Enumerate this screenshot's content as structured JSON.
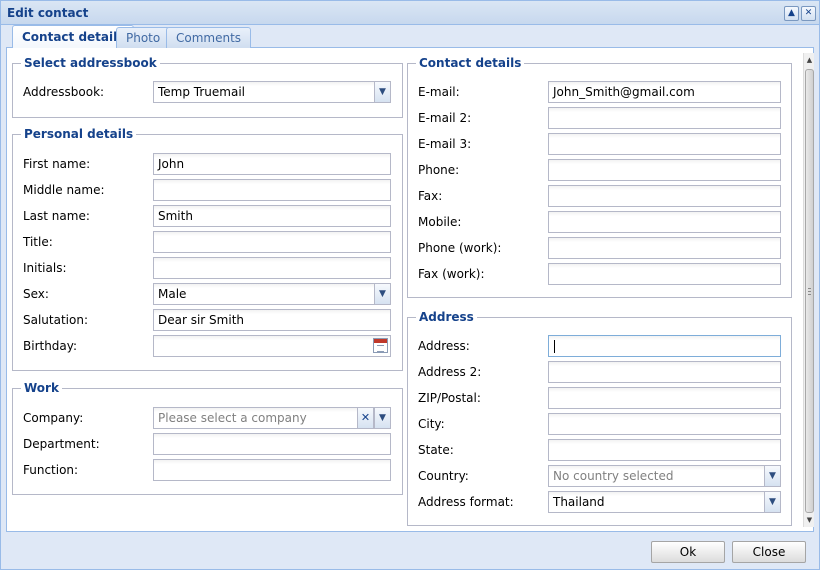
{
  "window": {
    "title": "Edit contact",
    "tools": [
      "collapse-icon",
      "close-icon"
    ]
  },
  "tabs": [
    {
      "label": "Contact details",
      "active": true
    },
    {
      "label": "Photo",
      "active": false
    },
    {
      "label": "Comments",
      "active": false
    }
  ],
  "addressbook_section": {
    "legend": "Select addressbook",
    "addressbook": {
      "label": "Addressbook:",
      "value": "Temp Truemail"
    }
  },
  "personal_section": {
    "legend": "Personal details",
    "first_name": {
      "label": "First name:",
      "value": "John"
    },
    "middle_name": {
      "label": "Middle name:",
      "value": ""
    },
    "last_name": {
      "label": "Last name:",
      "value": "Smith"
    },
    "title": {
      "label": "Title:",
      "value": ""
    },
    "initials": {
      "label": "Initials:",
      "value": ""
    },
    "sex": {
      "label": "Sex:",
      "value": "Male"
    },
    "salutation": {
      "label": "Salutation:",
      "value": "Dear sir Smith"
    },
    "birthday": {
      "label": "Birthday:",
      "value": ""
    }
  },
  "work_section": {
    "legend": "Work",
    "company": {
      "label": "Company:",
      "placeholder": "Please select a company"
    },
    "department": {
      "label": "Department:",
      "value": ""
    },
    "function": {
      "label": "Function:",
      "value": ""
    }
  },
  "contact_section": {
    "legend": "Contact details",
    "email": {
      "label": "E-mail:",
      "value": "John_Smith@gmail.com"
    },
    "email2": {
      "label": "E-mail 2:",
      "value": ""
    },
    "email3": {
      "label": "E-mail 3:",
      "value": ""
    },
    "phone": {
      "label": "Phone:",
      "value": ""
    },
    "fax": {
      "label": "Fax:",
      "value": ""
    },
    "mobile": {
      "label": "Mobile:",
      "value": ""
    },
    "phone_work": {
      "label": "Phone (work):",
      "value": ""
    },
    "fax_work": {
      "label": "Fax (work):",
      "value": ""
    }
  },
  "address_section": {
    "legend": "Address",
    "address": {
      "label": "Address:",
      "value": ""
    },
    "address2": {
      "label": "Address 2:",
      "value": ""
    },
    "zip": {
      "label": "ZIP/Postal:",
      "value": ""
    },
    "city": {
      "label": "City:",
      "value": ""
    },
    "state": {
      "label": "State:",
      "value": ""
    },
    "country": {
      "label": "Country:",
      "placeholder": "No country selected"
    },
    "address_format": {
      "label": "Address format:",
      "value": "Thailand"
    }
  },
  "footer": {
    "ok_label": "Ok",
    "close_label": "Close"
  },
  "colors": {
    "header_text": "#15428b",
    "frame": "#dfe8f6",
    "border": "#99bbe8"
  }
}
